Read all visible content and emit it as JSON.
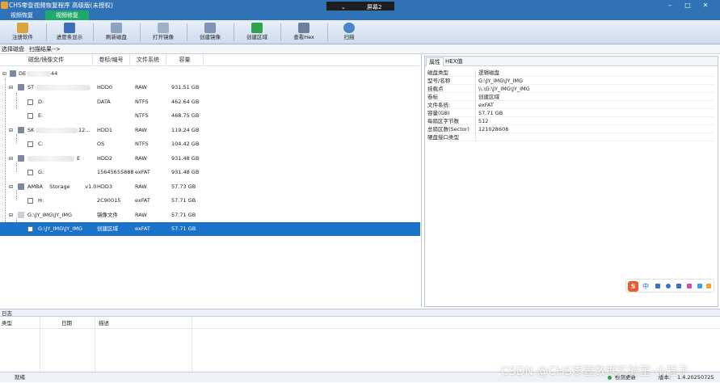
{
  "window": {
    "title": "CHS零壹视频恢复程序 高级版(未授权)",
    "screen_selector": "屏幕2"
  },
  "tabs": [
    {
      "label": "视频恢复"
    },
    {
      "label": "视频修复"
    }
  ],
  "toolbar": [
    {
      "label": "注册软件",
      "icon": "key-icon"
    },
    {
      "label": "进度条显示",
      "icon": "progress-icon"
    },
    {
      "label": "刷新磁盘",
      "icon": "refresh-disk-icon"
    },
    {
      "label": "打开镜像",
      "icon": "open-image-icon"
    },
    {
      "label": "创建镜像",
      "icon": "create-image-icon"
    },
    {
      "label": "创建区域",
      "icon": "create-region-icon"
    },
    {
      "label": "查看Hex",
      "icon": "view-hex-icon"
    },
    {
      "label": "扫描",
      "icon": "scan-icon"
    }
  ],
  "breadcrumbs": {
    "step1": "选择磁盘",
    "step2": "扫描结果-->"
  },
  "disk_table": {
    "headers": [
      "磁盘/镜像文件",
      "卷标/编号",
      "文件系统",
      "容量"
    ],
    "rows": [
      {
        "name": "DE",
        "name_suffix": "44",
        "label": "",
        "fs": "",
        "size": ""
      },
      {
        "name": "ST",
        "name_suffix": "",
        "label": "HDD0",
        "fs": "RAW",
        "size": "931.51 GB"
      },
      {
        "name": "D:",
        "label": "DATA",
        "fs": "NTFS",
        "size": "462.64 GB"
      },
      {
        "name": "E:",
        "label": "",
        "fs": "NTFS",
        "size": "468.75 GB"
      },
      {
        "name": "SK",
        "name_suffix": "12...",
        "label": "HDD1",
        "fs": "RAW",
        "size": "119.24 GB"
      },
      {
        "name": "C:",
        "label": "OS",
        "fs": "NTFS",
        "size": "104.42 GB"
      },
      {
        "name": "",
        "name_suffix": "E",
        "label": "HDD2",
        "fs": "RAW",
        "size": "931.48 GB"
      },
      {
        "name": "G:",
        "label": "15645655888",
        "fs": "exFAT",
        "size": "931.48 GB"
      },
      {
        "name": "AMBA    Storage         v1.0",
        "label": "HDD3",
        "fs": "RAW",
        "size": "57.73 GB"
      },
      {
        "name": "H:",
        "label": "2C90015",
        "fs": "exFAT",
        "size": "57.71 GB"
      },
      {
        "name": "G:\\JY_IMG\\JY_IMG",
        "label": "镜像文件",
        "fs": "RAW",
        "size": "57.71 GB"
      },
      {
        "name": "G:\\JY_IMG\\JY_IMG",
        "label": "创建区域",
        "fs": "exFAT",
        "size": "57.71 GB",
        "selected": true
      }
    ]
  },
  "properties": {
    "tabs": [
      "属性",
      "HEX值"
    ],
    "rows": [
      {
        "k": "磁盘类型",
        "v": "逻辑磁盘"
      },
      {
        "k": "型号/名称",
        "v": "G:\\JY_IMG\\JY_IMG"
      },
      {
        "k": "挂载点",
        "v": "\\\\.\\G:\\JY_IMG\\JY_IMG"
      },
      {
        "k": "卷标",
        "v": "创建区域"
      },
      {
        "k": "文件系统:",
        "v": "exFAT"
      },
      {
        "k": "容量(GB)",
        "v": "57.71 GB"
      },
      {
        "k": "每扇区字节数",
        "v": "512"
      },
      {
        "k": "总扇区数(Sector)",
        "v": "121028608"
      },
      {
        "k": "硬盘接口类型",
        "v": ""
      }
    ]
  },
  "ime": {
    "logo": "S",
    "mode": "中"
  },
  "log": {
    "title": "日志",
    "headers": [
      "类型",
      "日期",
      "描述"
    ]
  },
  "status": {
    "left": "就绪",
    "check_update": "检测更新",
    "version_label": "版本:",
    "version": "1.4.20250725"
  },
  "watermark": "CSDN @CHS零壹数据实验室-小程子",
  "colors": {
    "title_bar": "#2f72b6",
    "active_tab": "#1fa96a",
    "selection": "#1a73c8"
  }
}
